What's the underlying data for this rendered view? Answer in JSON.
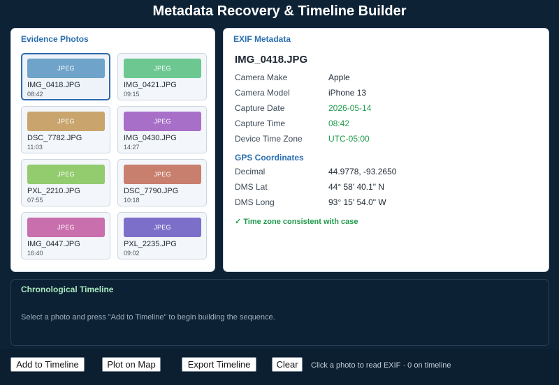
{
  "app": {
    "title": "Metadata Recovery & Timeline Builder"
  },
  "evidence": {
    "title": "Evidence Photos",
    "photos": [
      {
        "label": "JPEG",
        "name": "IMG_0418.JPG",
        "time": "08:42",
        "color": "#6fa3c9",
        "selected": true
      },
      {
        "label": "JPEG",
        "name": "IMG_0421.JPG",
        "time": "09:15",
        "color": "#6cc791"
      },
      {
        "label": "JPEG",
        "name": "DSC_7782.JPG",
        "time": "11:03",
        "color": "#c9a56d"
      },
      {
        "label": "JPEG",
        "name": "IMG_0430.JPG",
        "time": "14:27",
        "color": "#a86fc9"
      },
      {
        "label": "JPEG",
        "name": "PXL_2210.JPG",
        "time": "07:55",
        "color": "#93cb6f"
      },
      {
        "label": "JPEG",
        "name": "DSC_7790.JPG",
        "time": "10:18",
        "color": "#c97f6e"
      },
      {
        "label": "JPEG",
        "name": "IMG_0447.JPG",
        "time": "16:40",
        "color": "#c96fad"
      },
      {
        "label": "JPEG",
        "name": "PXL_2235.JPG",
        "time": "09:02",
        "color": "#7c6fc9"
      }
    ]
  },
  "exif": {
    "title": "EXIF Metadata",
    "filename": "IMG_0418.JPG",
    "fields": [
      {
        "key": "Camera Make",
        "value": "Apple"
      },
      {
        "key": "Camera Model",
        "value": "iPhone 13"
      },
      {
        "key": "Capture Date",
        "value": "2026-05-14",
        "highlight": true
      },
      {
        "key": "Capture Time",
        "value": "08:42",
        "highlight": true
      },
      {
        "key": "Device Time Zone",
        "value": "UTC-05:00",
        "highlight": true
      }
    ],
    "gps_title": "GPS Coordinates",
    "gps": [
      {
        "key": "Decimal",
        "value": "44.9778, -93.2650"
      },
      {
        "key": "DMS Lat",
        "value": "44° 58' 40.1\" N"
      },
      {
        "key": "DMS Long",
        "value": "93° 15' 54.0\" W"
      }
    ],
    "tz_status": "✓ Time zone consistent with case",
    "highlight_color": "#1f9a4a"
  },
  "timeline": {
    "title": "Chronological Timeline",
    "hint": "Select a photo and press \"Add to Timeline\" to begin building the sequence."
  },
  "toolbar": {
    "add_label": "Add to Timeline",
    "map_label": "Plot on Map",
    "export_label": "Export Timeline",
    "clear_label": "Clear",
    "status": "Click a photo to read EXIF · 0 on timeline"
  }
}
